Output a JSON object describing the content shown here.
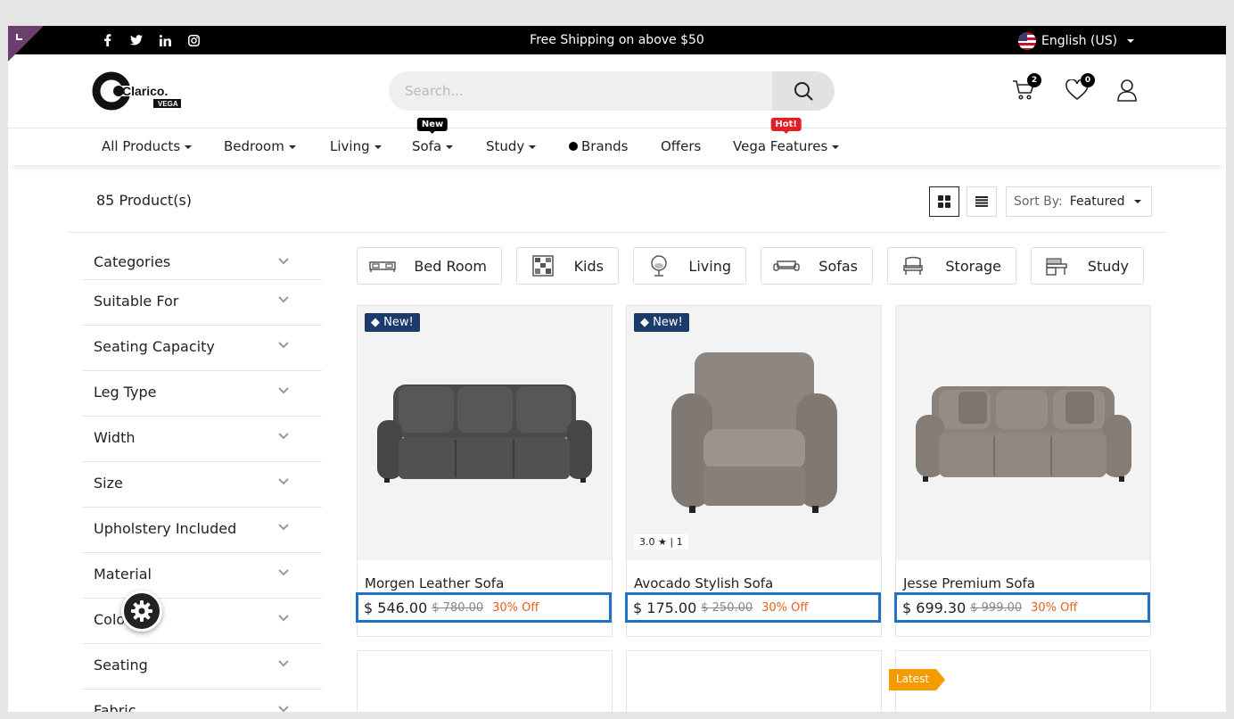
{
  "topbar": {
    "social_icons": [
      "facebook-icon",
      "twitter-icon",
      "linkedin-icon",
      "instagram-icon"
    ],
    "shipping_text": "Free Shipping on above $50",
    "language": "English (US)"
  },
  "header": {
    "logo_text": "Clarico.",
    "logo_sub": "VEGA",
    "search_placeholder": "Search...",
    "cart_count": "2",
    "wishlist_count": "0"
  },
  "nav": {
    "items": [
      {
        "label": "All Products"
      },
      {
        "label": "Bedroom"
      },
      {
        "label": "Living"
      },
      {
        "label": "Sofa",
        "badge": "New"
      },
      {
        "label": "Study"
      },
      {
        "label": "Brands"
      },
      {
        "label": "Offers"
      },
      {
        "label": "Vega Features",
        "badge": "Hot!"
      }
    ]
  },
  "toolbar": {
    "product_count": "85 Product(s)",
    "sort_label": "Sort By:",
    "sort_value": "Featured"
  },
  "sidebar": {
    "filters": [
      "Categories",
      "Suitable For",
      "Seating Capacity",
      "Leg Type",
      "Width",
      "Size",
      "Upholstery Included",
      "Material",
      "Color",
      "Seating",
      "Fabric"
    ]
  },
  "categories": [
    "Bed Room",
    "Kids",
    "Living",
    "Sofas",
    "Storage",
    "Study"
  ],
  "products": [
    {
      "name": "Morgen Leather Sofa",
      "price": "$ 546.00",
      "old_price": "$ 780.00",
      "discount": "30% Off",
      "tag": "New!",
      "rating": null
    },
    {
      "name": "Avocado Stylish Sofa",
      "price": "$ 175.00",
      "old_price": "$ 250.00",
      "discount": "30% Off",
      "tag": "New!",
      "rating": "3.0",
      "rating_count": "1"
    },
    {
      "name": "Jesse Premium Sofa",
      "price": "$ 699.30",
      "old_price": "$ 999.00",
      "discount": "30% Off",
      "tag": null,
      "rating": null
    }
  ],
  "next_row": {
    "latest_tag": "Latest"
  },
  "colors": {
    "accent_blue": "#1f73c4",
    "tag_navy": "#1b3c6b",
    "discount_orange": "#e8601c",
    "hot_red": "#e31e24",
    "latest_orange": "#f59b00"
  }
}
